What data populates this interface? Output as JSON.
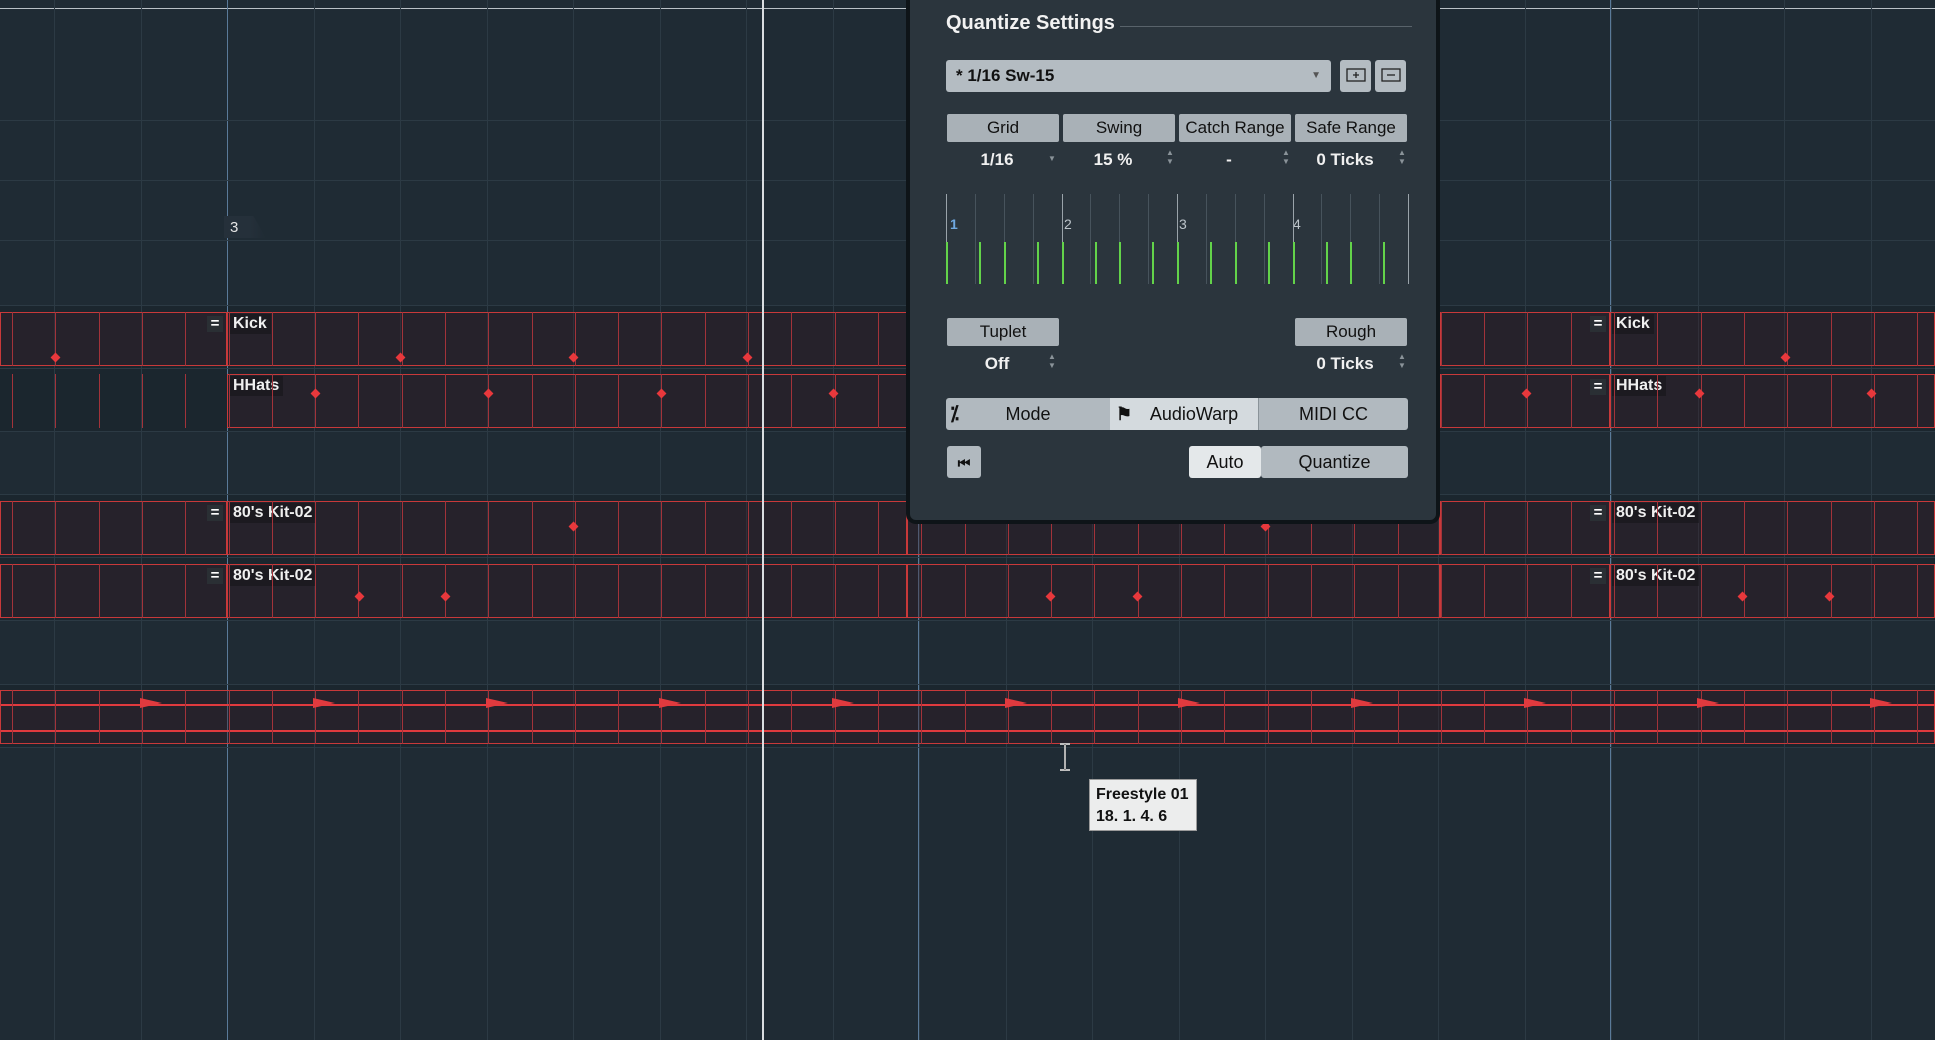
{
  "marker": {
    "label": "3"
  },
  "tracks": {
    "kick_label": "Kick",
    "hhats_label": "HHats",
    "kit_label_1": "80's Kit-02",
    "kit_label_2": "80's Kit-02"
  },
  "quantize": {
    "title": "Quantize Settings",
    "preset": "* 1/16  Sw-15",
    "columns": [
      {
        "label": "Grid",
        "value": "1/16"
      },
      {
        "label": "Swing",
        "value": "15 %"
      },
      {
        "label": "Catch Range",
        "value": "-"
      },
      {
        "label": "Safe Range",
        "value": "0 Ticks"
      }
    ],
    "grid_numbers": [
      "1",
      "2",
      "3",
      "4"
    ],
    "tuplet": {
      "label": "Tuplet",
      "value": "Off"
    },
    "rough": {
      "label": "Rough",
      "value": "0 Ticks"
    },
    "mode": {
      "mode_label": "Mode",
      "audiowarp_label": "AudioWarp",
      "midicc_label": "MIDI CC"
    },
    "auto_label": "Auto",
    "quantize_label": "Quantize"
  },
  "tooltip": {
    "line1": "Freestyle 01",
    "line2": "18. 1. 4.  6"
  },
  "colors": {
    "part_border": "#c8393a",
    "note": "#e8383c",
    "grid_green": "#63d34a",
    "panel_bg": "#2b353d"
  }
}
